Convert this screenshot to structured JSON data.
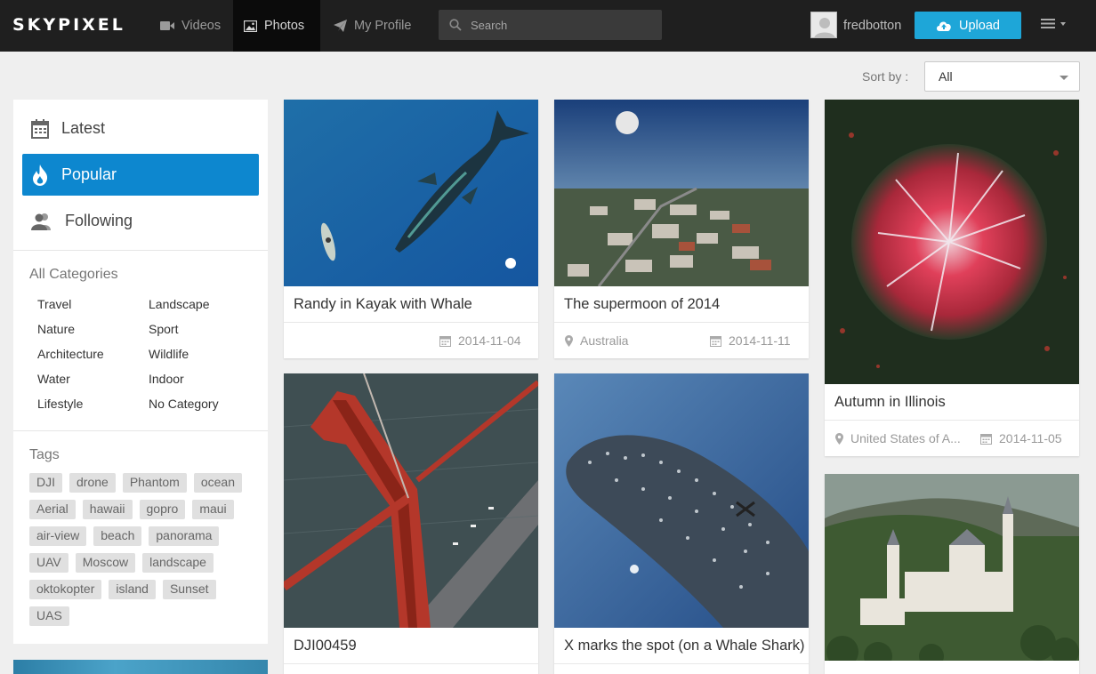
{
  "header": {
    "logo": "SKYPIXEL",
    "nav": [
      {
        "label": "Videos",
        "icon": "video-camera-icon"
      },
      {
        "label": "Photos",
        "icon": "image-icon"
      },
      {
        "label": "My Profile",
        "icon": "paper-plane-icon"
      }
    ],
    "search_placeholder": "Search",
    "username": "fredbotton",
    "upload_label": "Upload"
  },
  "sort": {
    "label": "Sort by :",
    "value": "All"
  },
  "sidebar": {
    "nav": [
      {
        "label": "Latest",
        "icon": "calendar-icon"
      },
      {
        "label": "Popular",
        "icon": "fire-icon",
        "active": true
      },
      {
        "label": "Following",
        "icon": "users-icon"
      }
    ],
    "categories_title": "All Categories",
    "categories": [
      "Travel",
      "Landscape",
      "Nature",
      "Sport",
      "Architecture",
      "Wildlife",
      "Water",
      "Indoor",
      "Lifestyle",
      "No Category"
    ],
    "tags_title": "Tags",
    "tags": [
      "DJI",
      "drone",
      "Phantom",
      "ocean",
      "Aerial",
      "hawaii",
      "gopro",
      "maui",
      "air-view",
      "beach",
      "panorama",
      "UAV",
      "Moscow",
      "landscape",
      "oktokopter",
      "island",
      "Sunset",
      "UAS"
    ]
  },
  "cards": [
    {
      "title": "Randy in Kayak with Whale",
      "location": "",
      "date": "2014-11-04"
    },
    {
      "title": "The supermoon of 2014",
      "location": "Australia",
      "date": "2014-11-11"
    },
    {
      "title": "Autumn in Illinois",
      "location": "United States of A...",
      "date": "2014-11-05"
    },
    {
      "title": "DJI00459",
      "location": "",
      "date": ""
    },
    {
      "title": "X marks the spot (on a Whale Shark)",
      "location": "",
      "date": ""
    },
    {
      "title": "",
      "location": "",
      "date": ""
    }
  ],
  "colors": {
    "accent": "#0d87cf",
    "upload": "#1ea6d8",
    "topbar": "#1f1f1f"
  }
}
